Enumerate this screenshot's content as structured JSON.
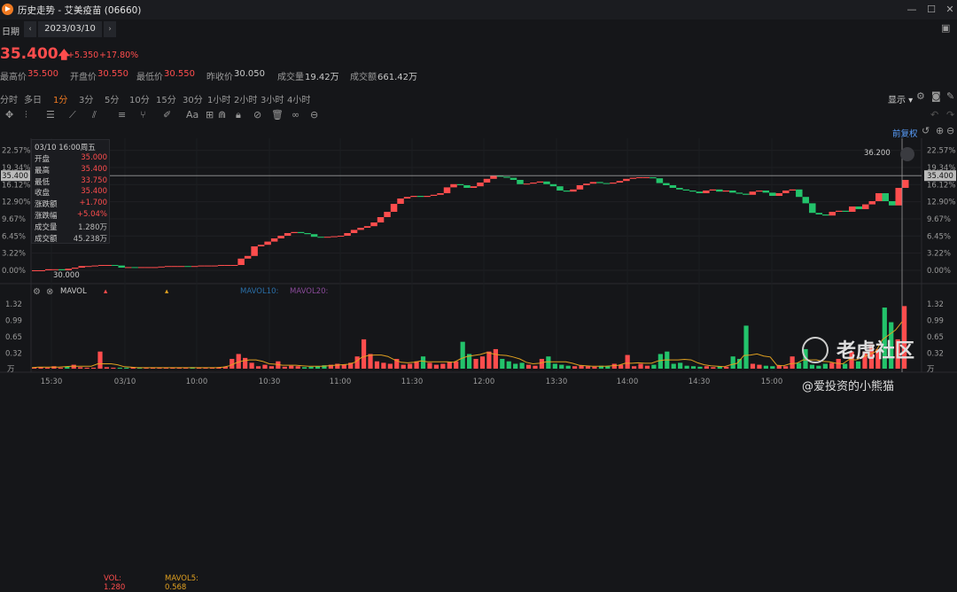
{
  "window": {
    "title": "历史走势 - 艾美疫苗 (06660)"
  },
  "datebar": {
    "label": "日期",
    "date": "2023/03/10",
    "prev": "‹",
    "next": "›"
  },
  "quote": {
    "price": "35.400",
    "arrow": "🡅",
    "change": "+5.350",
    "change_pct": "+17.80%",
    "stats": [
      {
        "label": "最高价",
        "value": "35.500",
        "red": true
      },
      {
        "label": "开盘价",
        "value": "30.550",
        "red": true
      },
      {
        "label": "最低价",
        "value": "30.550",
        "red": true
      },
      {
        "label": "昨收价",
        "value": "30.050",
        "red": false
      },
      {
        "label": "成交量",
        "value": "19.42万",
        "red": false
      },
      {
        "label": "成交额",
        "value": "661.42万",
        "red": false
      }
    ]
  },
  "periods": [
    "分时",
    "多日",
    "1分",
    "3分",
    "5分",
    "10分",
    "15分",
    "30分",
    "1小时",
    "2小时",
    "3小时",
    "4小时"
  ],
  "active_period": "1分",
  "display_label": "显示",
  "restore_label": "前复权",
  "infobox": {
    "header": "03/10 16:00周五",
    "rows": [
      {
        "k": "开盘",
        "v": "35.000",
        "c": "red"
      },
      {
        "k": "最高",
        "v": "35.400",
        "c": "red"
      },
      {
        "k": "最低",
        "v": "33.750",
        "c": "red"
      },
      {
        "k": "收盘",
        "v": "35.400",
        "c": "red"
      },
      {
        "k": "涨跌额",
        "v": "+1.700",
        "c": "red"
      },
      {
        "k": "涨跌幅",
        "v": "+5.04%",
        "c": "red"
      },
      {
        "k": "成交量",
        "v": "1.280万",
        "c": "gray"
      },
      {
        "k": "成交额",
        "v": "45.238万",
        "c": "gray"
      }
    ]
  },
  "price_tag": "35.400",
  "marker_high": "36.200",
  "marker_low": "30.000",
  "vol_legend": {
    "name": "MAVOL",
    "vol": "VOL: 1.280",
    "mavol5": "MAVOL5: 0.568",
    "mavol10": "MAVOL10:",
    "mavol20": "MAVOL20:",
    "unit": "万"
  },
  "colors": {
    "up": "#ff4d4d",
    "down": "#23c36b",
    "accent": "#f07a22",
    "vol_ma5": "#e0a020"
  },
  "watermark": {
    "text": "老虎社区",
    "handle": "@爱投资的小熊猫"
  },
  "chart_data": [
    {
      "type": "line",
      "title": "",
      "y_ticks_left": [
        "22.57%",
        "19.34%",
        "16.12%",
        "12.90%",
        "9.67%",
        "6.45%",
        "3.22%",
        "0.00%"
      ],
      "y_ticks_right": [
        "22.57%",
        "19.34%",
        "16.12%",
        "12.90%",
        "9.67%",
        "6.45%",
        "3.22%",
        "0.00%"
      ],
      "y_tick_values": [
        22.57,
        19.34,
        16.12,
        12.9,
        9.67,
        6.45,
        3.22,
        0.0
      ],
      "ylim": [
        -0.5,
        24.5
      ],
      "x_ticks": [
        "15:30",
        "03/10",
        "10:00",
        "10:30",
        "11:00",
        "11:30",
        "12:00",
        "13:30",
        "14:00",
        "14:30",
        "15:00"
      ],
      "series": [
        {
          "values": [
            0.0,
            0.0,
            0.2,
            0.2,
            0.0,
            0.3,
            0.5,
            0.8,
            0.8,
            0.9,
            1.0,
            1.0,
            0.9,
            0.5,
            0.6,
            0.5,
            0.6,
            0.6,
            0.6,
            0.7,
            0.8,
            0.8,
            0.8,
            0.7,
            0.8,
            0.9,
            0.9,
            0.9,
            1.0,
            1.0,
            1.0,
            2.2,
            2.7,
            4.5,
            4.8,
            5.4,
            6.0,
            6.5,
            7.0,
            7.2,
            7.0,
            6.8,
            6.3,
            6.2,
            6.3,
            6.4,
            6.5,
            7.0,
            7.6,
            8.0,
            8.3,
            9.0,
            10.0,
            11.0,
            12.5,
            13.5,
            13.8,
            14.0,
            13.8,
            14.0,
            14.2,
            14.5,
            15.6,
            16.2,
            16.0,
            15.5,
            15.8,
            16.5,
            17.2,
            17.8,
            17.6,
            17.4,
            17.0,
            16.2,
            16.3,
            16.5,
            16.7,
            16.2,
            15.8,
            15.0,
            14.8,
            15.2,
            16.0,
            16.3,
            16.6,
            16.4,
            16.3,
            16.5,
            16.8,
            17.2,
            17.4,
            17.5,
            17.5,
            17.3,
            16.4,
            16.0,
            15.5,
            15.2,
            15.0,
            14.8,
            14.5,
            15.0,
            15.2,
            14.8,
            15.0,
            14.6,
            14.4,
            14.2,
            14.8,
            15.0,
            14.6,
            14.0,
            14.5,
            15.0,
            15.2,
            13.8,
            12.6,
            10.8,
            10.5,
            10.3,
            11.0,
            11.2,
            11.0,
            12.0,
            11.5,
            12.4,
            13.0,
            14.5,
            13.0,
            12.2,
            15.5,
            17.0
          ]
        }
      ]
    },
    {
      "type": "bar",
      "title": "",
      "y_ticks": [
        "1.32",
        "0.99",
        "0.65",
        "0.32"
      ],
      "y_tick_values": [
        1.32,
        0.99,
        0.65,
        0.32
      ],
      "ylim": [
        0,
        1.45
      ],
      "x_ticks": [
        "15:30",
        "03/10",
        "10:00",
        "10:30",
        "11:00",
        "11:30",
        "12:00",
        "13:30",
        "14:00",
        "14:30",
        "15:00"
      ],
      "series": [
        {
          "values": [
            0.02,
            0.03,
            0.02,
            0.05,
            0.02,
            0.04,
            0.08,
            0.03,
            0.02,
            0.02,
            0.35,
            0.03,
            0.02,
            0.02,
            0.02,
            0.03,
            0.02,
            0.02,
            0.02,
            0.02,
            0.02,
            0.02,
            0.02,
            0.02,
            0.03,
            0.02,
            0.02,
            0.02,
            0.03,
            0.04,
            0.2,
            0.3,
            0.22,
            0.12,
            0.05,
            0.08,
            0.05,
            0.15,
            0.04,
            0.06,
            0.05,
            0.03,
            0.04,
            0.05,
            0.07,
            0.08,
            0.1,
            0.09,
            0.12,
            0.25,
            0.6,
            0.3,
            0.15,
            0.12,
            0.1,
            0.2,
            0.08,
            0.1,
            0.15,
            0.25,
            0.12,
            0.08,
            0.1,
            0.14,
            0.15,
            0.55,
            0.3,
            0.2,
            0.25,
            0.35,
            0.4,
            0.2,
            0.15,
            0.1,
            0.12,
            0.08,
            0.06,
            0.2,
            0.25,
            0.1,
            0.08,
            0.06,
            0.05,
            0.07,
            0.05,
            0.04,
            0.06,
            0.05,
            0.1,
            0.08,
            0.28,
            0.05,
            0.1,
            0.06,
            0.08,
            0.3,
            0.35,
            0.1,
            0.12,
            0.06,
            0.05,
            0.04,
            0.05,
            0.03,
            0.05,
            0.04,
            0.25,
            0.2,
            0.88,
            0.1,
            0.08,
            0.06,
            0.05,
            0.07,
            0.05,
            0.25,
            0.12,
            0.4,
            0.08,
            0.06,
            0.1,
            0.12,
            0.2,
            0.1,
            0.35,
            0.15,
            0.35,
            0.5,
            0.4,
            1.25,
            0.95,
            0.6,
            1.28
          ]
        },
        {
          "name": "MAVOL5",
          "values": [
            0.02,
            0.03,
            0.03,
            0.03,
            0.03,
            0.04,
            0.05,
            0.05,
            0.05,
            0.05,
            0.1,
            0.1,
            0.1,
            0.08,
            0.04,
            0.03,
            0.02,
            0.02,
            0.02,
            0.02,
            0.02,
            0.02,
            0.02,
            0.02,
            0.02,
            0.02,
            0.02,
            0.02,
            0.02,
            0.03,
            0.06,
            0.12,
            0.16,
            0.18,
            0.18,
            0.15,
            0.1,
            0.09,
            0.07,
            0.07,
            0.07,
            0.06,
            0.05,
            0.05,
            0.05,
            0.06,
            0.07,
            0.08,
            0.09,
            0.13,
            0.23,
            0.27,
            0.28,
            0.28,
            0.25,
            0.18,
            0.13,
            0.12,
            0.13,
            0.16,
            0.14,
            0.14,
            0.14,
            0.14,
            0.13,
            0.2,
            0.25,
            0.27,
            0.29,
            0.33,
            0.3,
            0.28,
            0.27,
            0.24,
            0.2,
            0.13,
            0.1,
            0.11,
            0.14,
            0.14,
            0.14,
            0.14,
            0.11,
            0.07,
            0.06,
            0.05,
            0.05,
            0.05,
            0.06,
            0.07,
            0.11,
            0.11,
            0.12,
            0.11,
            0.11,
            0.16,
            0.18,
            0.18,
            0.18,
            0.19,
            0.18,
            0.12,
            0.08,
            0.06,
            0.05,
            0.04,
            0.08,
            0.11,
            0.27,
            0.28,
            0.3,
            0.26,
            0.24,
            0.07,
            0.06,
            0.1,
            0.11,
            0.18,
            0.18,
            0.18,
            0.15,
            0.14,
            0.11,
            0.1,
            0.19,
            0.18,
            0.23,
            0.29,
            0.35,
            0.59,
            0.69,
            0.79,
            0.96
          ]
        }
      ]
    }
  ]
}
